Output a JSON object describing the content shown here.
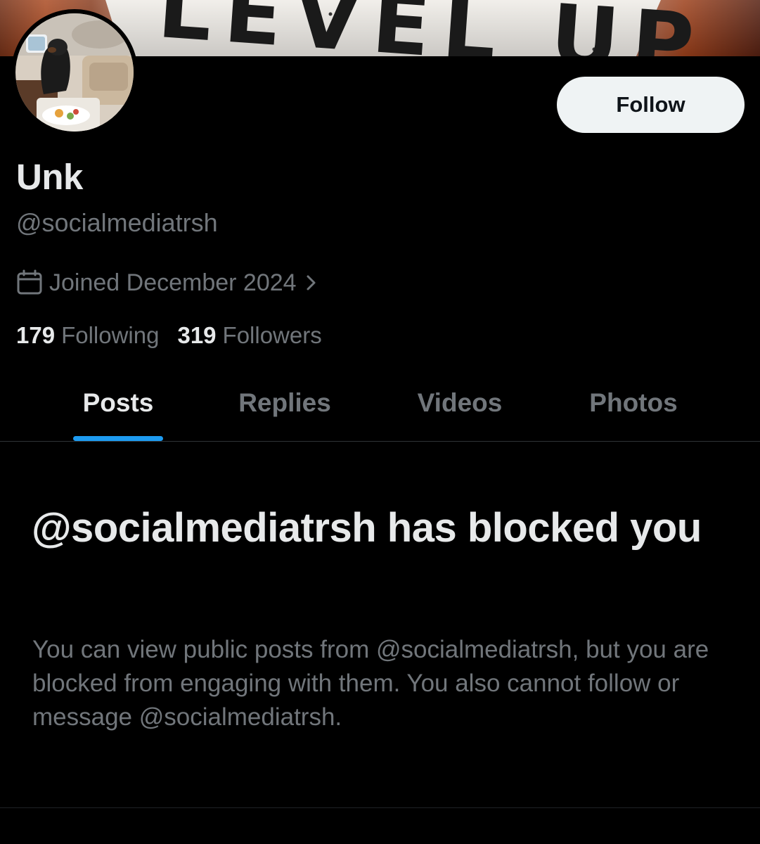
{
  "banner": {
    "text": "LEVEL UP"
  },
  "header": {
    "follow_label": "Follow"
  },
  "profile": {
    "display_name": "Unk",
    "handle": "@socialmediatrsh",
    "joined": "Joined December 2024",
    "following_count": "179",
    "following_label": "Following",
    "followers_count": "319",
    "followers_label": "Followers"
  },
  "tabs": [
    {
      "label": "Posts",
      "active": true
    },
    {
      "label": "Replies",
      "active": false
    },
    {
      "label": "Videos",
      "active": false
    },
    {
      "label": "Photos",
      "active": false
    }
  ],
  "blocked": {
    "title": "@socialmediatrsh has blocked you",
    "description": "You can view public posts from @socialmediatrsh, but you are blocked from engaging with them. You also cannot follow or message @socialmediatrsh."
  },
  "colors": {
    "background": "#000000",
    "primary_text": "#e7e9ea",
    "secondary_text": "#71767b",
    "accent": "#1d9bf0",
    "follow_button_bg": "#eff3f4",
    "divider": "#2f3336"
  },
  "icons": {
    "joined": "calendar-icon",
    "joined_more": "chevron-right-icon"
  }
}
